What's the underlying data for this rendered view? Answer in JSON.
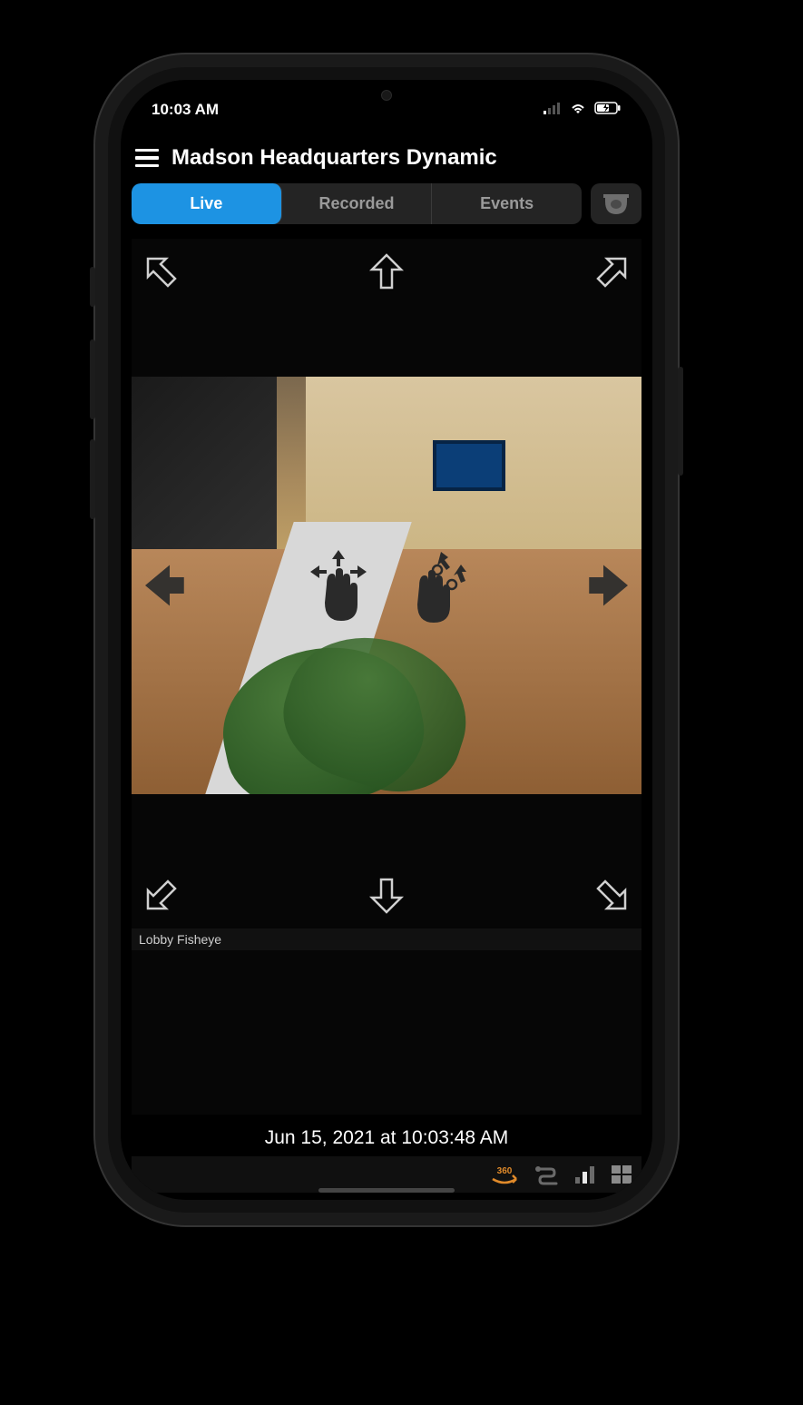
{
  "status": {
    "time": "10:03 AM"
  },
  "header": {
    "title": "Madson Headquarters Dynamic"
  },
  "tabs": {
    "live": "Live",
    "recorded": "Recorded",
    "events": "Events",
    "active": "live"
  },
  "camera": {
    "label": "Lobby Fisheye"
  },
  "timestamp": "Jun 15, 2021 at 10:03:48 AM",
  "icons": {
    "rotate360": "360"
  },
  "colors": {
    "accent": "#1d93e3",
    "rotate360": "#e08a2a"
  }
}
